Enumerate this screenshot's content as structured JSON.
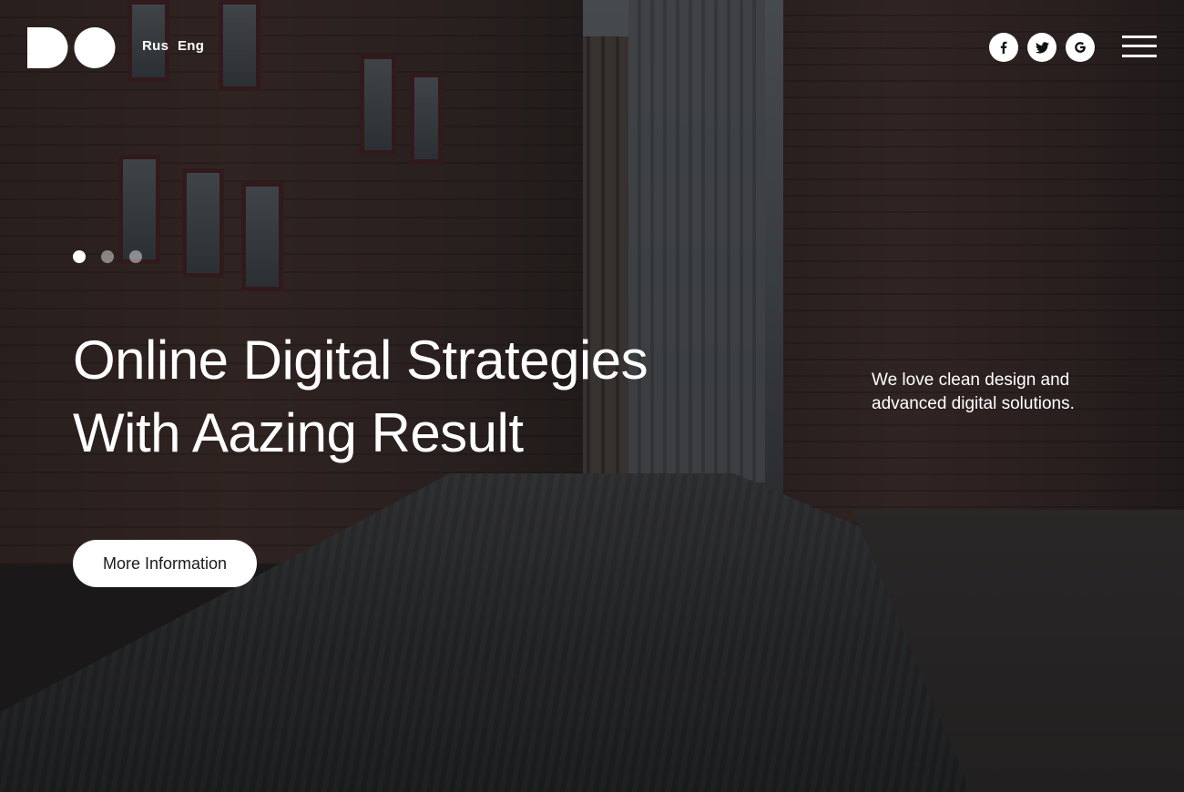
{
  "header": {
    "logo_icon": "do-logo",
    "languages": [
      "Rus",
      "Eng"
    ],
    "social": [
      {
        "name": "facebook-icon",
        "glyph": "f"
      },
      {
        "name": "twitter-icon",
        "glyph": "twitter-bird"
      },
      {
        "name": "google-icon",
        "glyph": "G"
      }
    ],
    "menu_icon": "hamburger-menu-icon"
  },
  "slider": {
    "dots": 3,
    "active_index": 0
  },
  "hero": {
    "title_line1": "Online Digital Strategies",
    "title_line2": "With Aazing Result",
    "button_label": "More Information"
  },
  "tagline": {
    "line1": "We love clean design and",
    "line2": "advanced digital solutions."
  },
  "colors": {
    "text": "#ffffff",
    "button_bg": "#ffffff",
    "button_text": "#1b1b1b",
    "overlay": "rgba(12,12,14,0.55)"
  }
}
